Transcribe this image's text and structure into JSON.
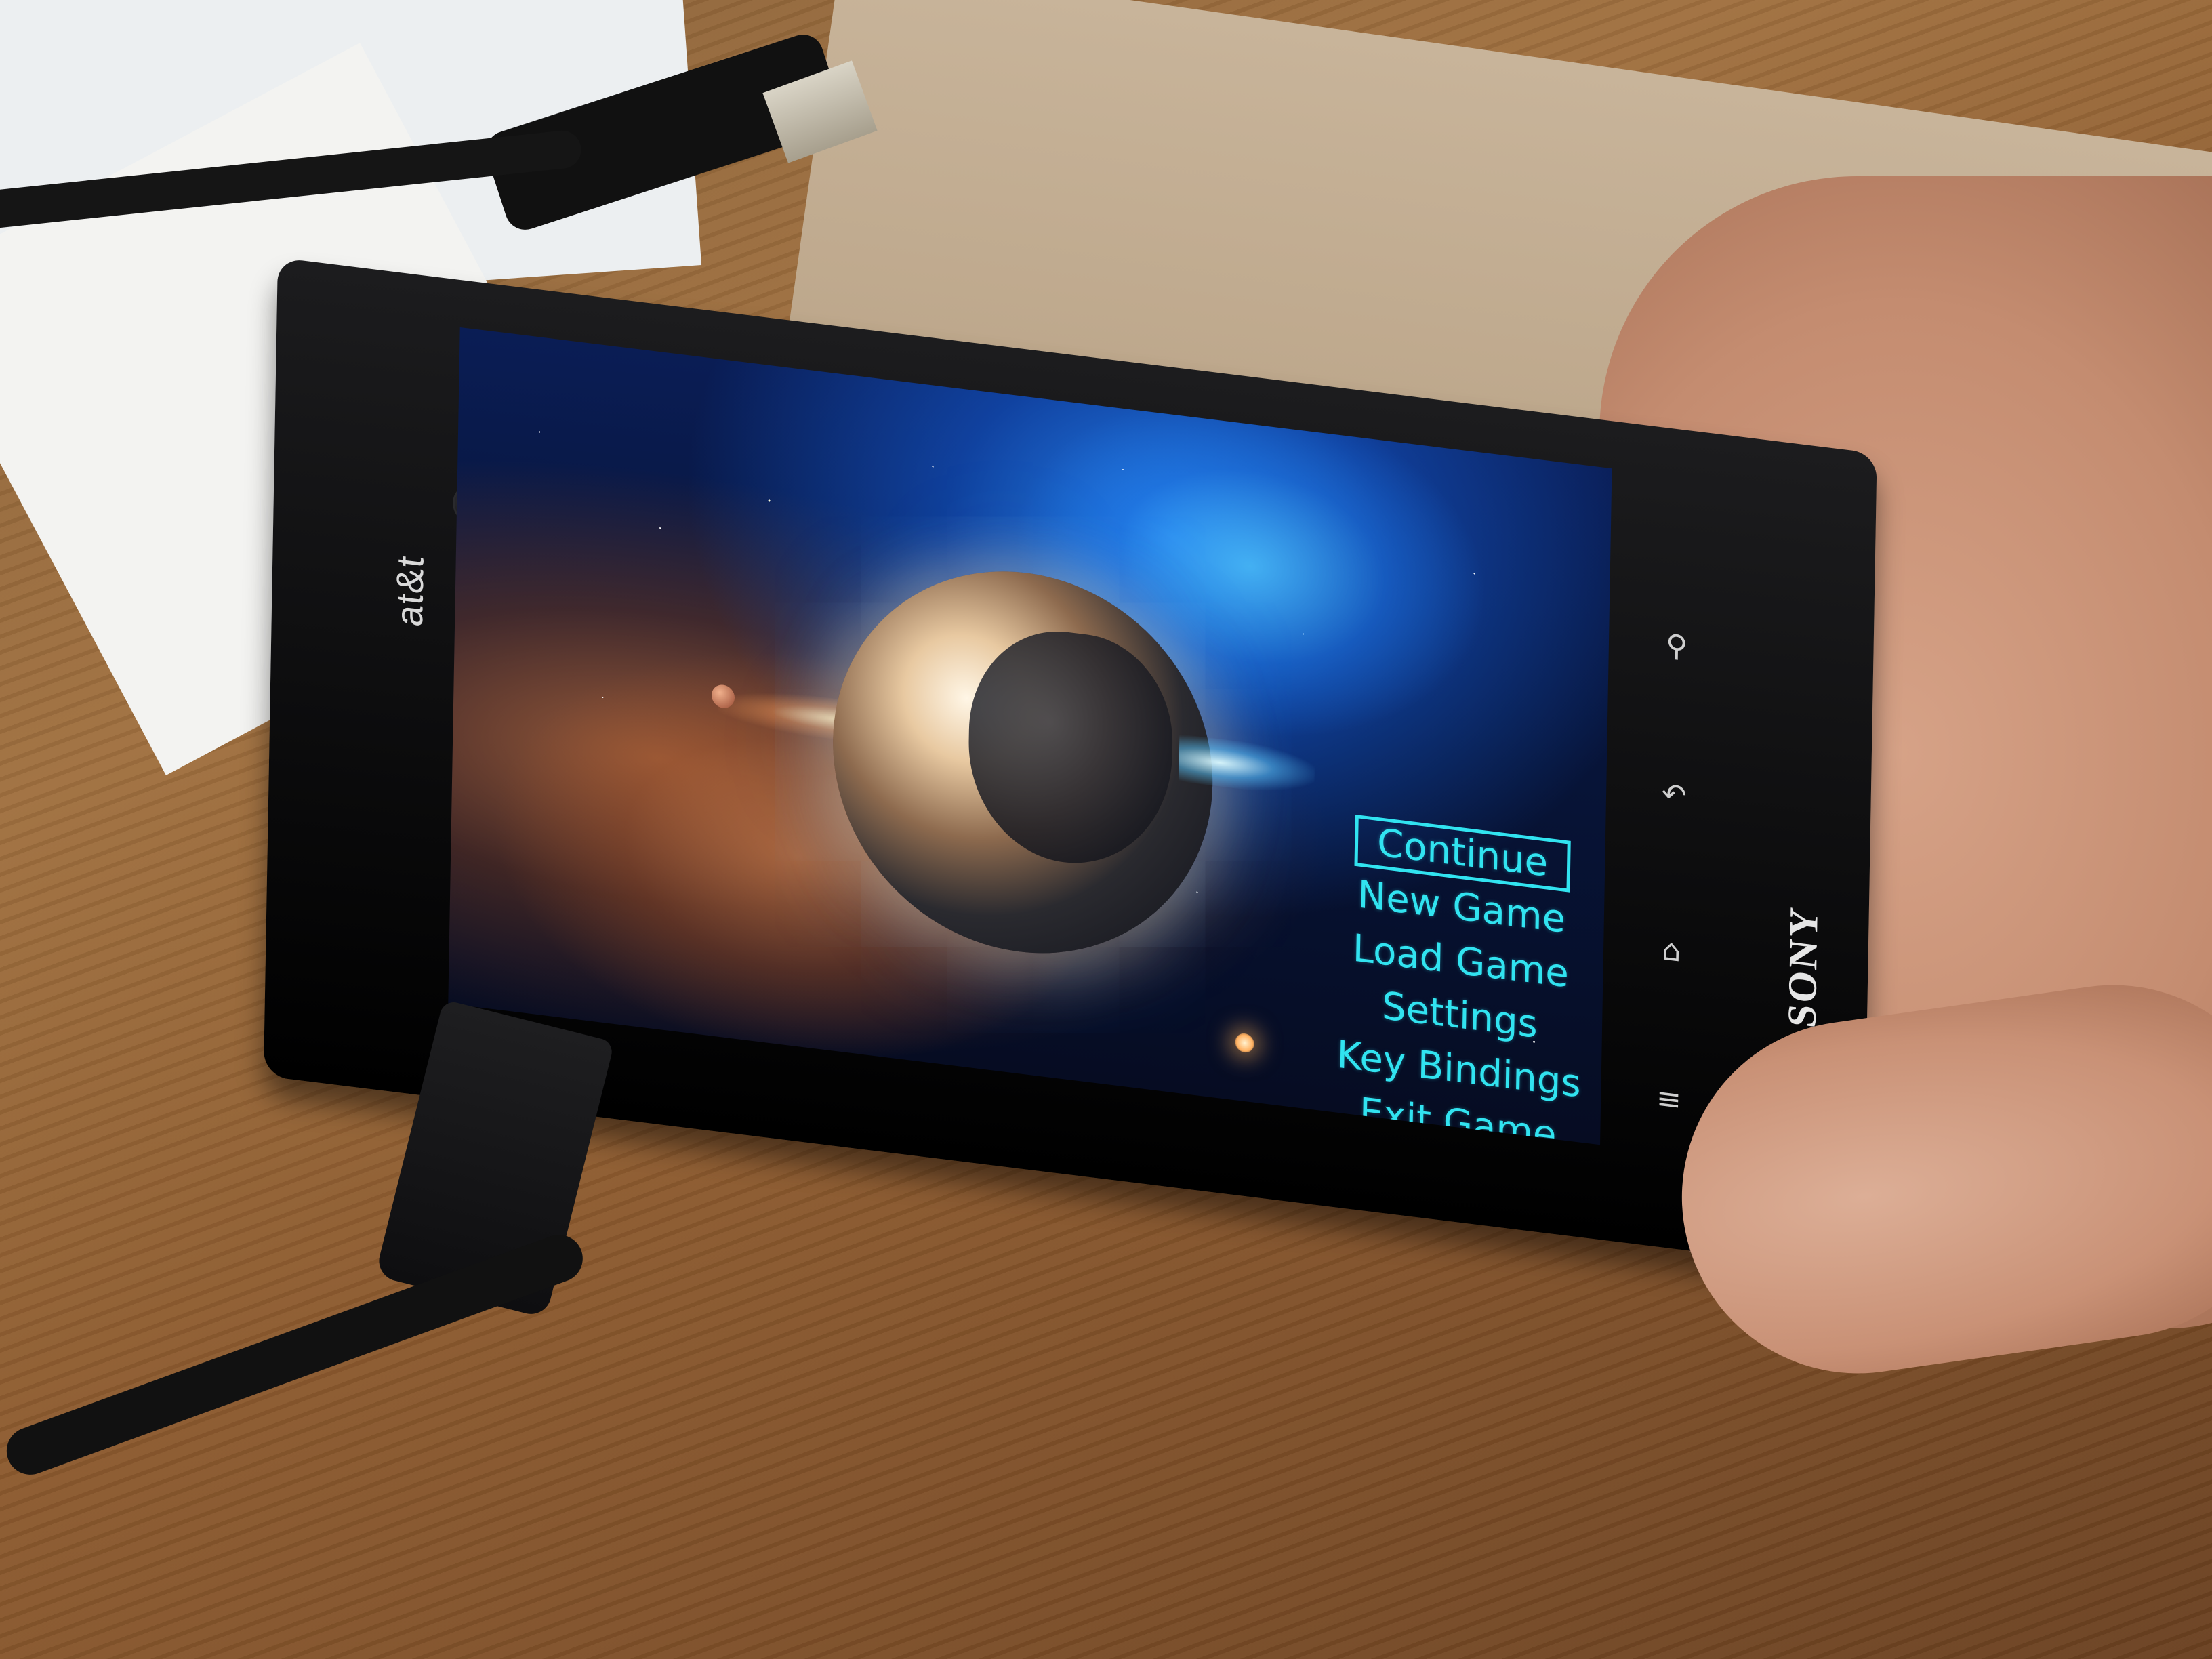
{
  "device": {
    "carrier_logo": "at&t",
    "manufacturer_logo": "SONY"
  },
  "game_menu": {
    "items": [
      {
        "label": "Continue",
        "selected": true
      },
      {
        "label": "New Game",
        "selected": false
      },
      {
        "label": "Load Game",
        "selected": false
      },
      {
        "label": "Settings",
        "selected": false
      },
      {
        "label": "Key Bindings",
        "selected": false
      },
      {
        "label": "Exit Game",
        "selected": false
      }
    ],
    "text_color": "#31e3f0"
  },
  "hardware_buttons": [
    {
      "name": "search",
      "icon": "magnifier-icon",
      "glyph": "⚲"
    },
    {
      "name": "back",
      "icon": "back-arrow-icon",
      "glyph": "↶"
    },
    {
      "name": "home",
      "icon": "home-icon",
      "glyph": "⌂"
    },
    {
      "name": "menu",
      "icon": "menu-icon",
      "glyph": "≡"
    }
  ]
}
